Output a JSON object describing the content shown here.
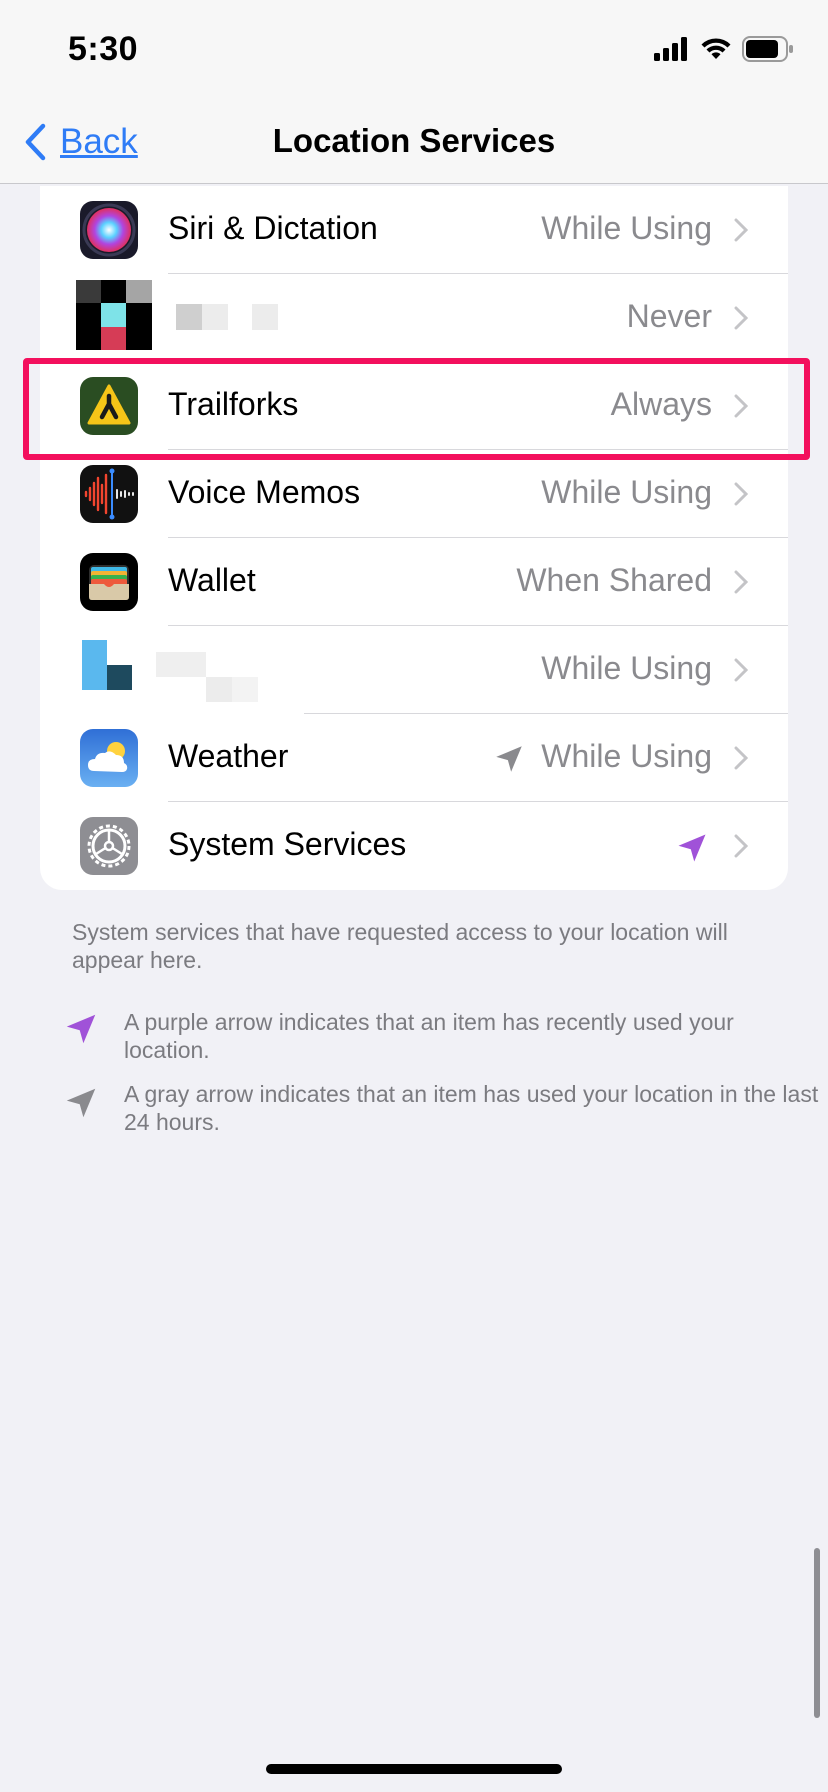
{
  "status_bar": {
    "time": "5:30"
  },
  "nav": {
    "back_label": "Back",
    "title": "Location Services"
  },
  "rows": [
    {
      "label": "Siri & Dictation",
      "value": "While Using",
      "icon": "siri-icon"
    },
    {
      "label": "",
      "value": "Never",
      "icon": "pixelated-app-icon"
    },
    {
      "label": "Trailforks",
      "value": "Always",
      "icon": "trailforks-icon"
    },
    {
      "label": "Voice Memos",
      "value": "While Using",
      "icon": "voice-memos-icon"
    },
    {
      "label": "Wallet",
      "value": "When Shared",
      "icon": "wallet-icon"
    },
    {
      "label": "",
      "value": "While Using",
      "icon": "pixelated-app-icon"
    },
    {
      "label": "Weather",
      "value": "While Using",
      "icon": "weather-icon",
      "location_arrow": "gray"
    },
    {
      "label": "System Services",
      "value": "",
      "icon": "gear-icon",
      "location_arrow": "purple"
    }
  ],
  "footer": {
    "description": "System services that have requested access to your location will appear here.",
    "purple_legend": "A purple arrow indicates that an item has recently used your location.",
    "gray_legend": "A gray arrow indicates that an item has used your location in the last 24 hours."
  },
  "colors": {
    "accent": "#2f7cf6",
    "highlight": "#f3105d",
    "purple_arrow": "#a052d8",
    "gray_arrow": "#8a8a8e"
  }
}
